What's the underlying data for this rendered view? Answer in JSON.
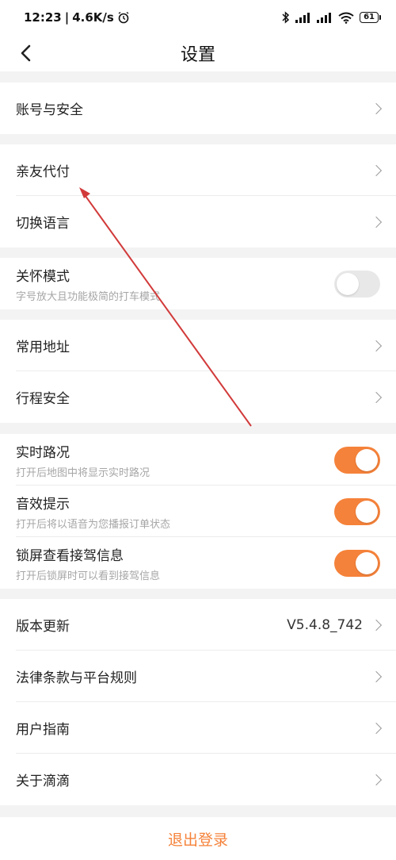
{
  "status_bar": {
    "time": "12:23",
    "speed": "4.6K/s",
    "battery": "61"
  },
  "header": {
    "title": "设置"
  },
  "settings": {
    "account": "账号与安全",
    "family_pay": "亲友代付",
    "language": "切换语言",
    "care_mode": {
      "label": "关怀模式",
      "desc": "字号放大且功能极简的打车模式",
      "enabled": false
    },
    "common_address": "常用地址",
    "trip_safety": "行程安全",
    "traffic": {
      "label": "实时路况",
      "desc": "打开后地图中将显示实时路况",
      "enabled": true
    },
    "sound": {
      "label": "音效提示",
      "desc": "打开后将以语音为您播报订单状态",
      "enabled": true
    },
    "lockscreen": {
      "label": "锁屏查看接驾信息",
      "desc": "打开后锁屏时可以看到接驾信息",
      "enabled": true
    },
    "version": {
      "label": "版本更新",
      "value": "V5.4.8_742"
    },
    "legal": "法律条款与平台规则",
    "guide": "用户指南",
    "about": "关于滴滴"
  },
  "logout": "退出登录",
  "colors": {
    "accent": "#f5823a",
    "annotation_arrow": "#d23a3a"
  }
}
